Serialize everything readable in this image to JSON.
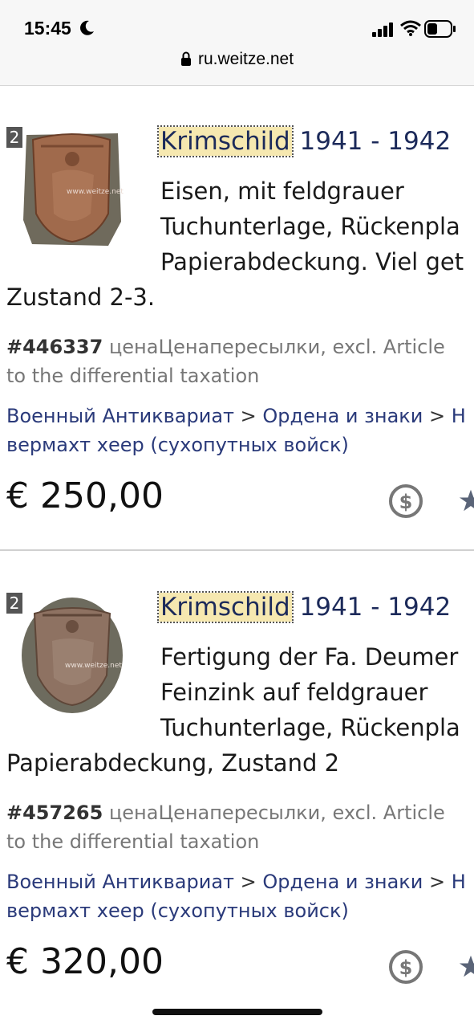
{
  "status": {
    "time": "15:45"
  },
  "browser": {
    "url": "ru.weitze.net"
  },
  "listings": [
    {
      "rank": "2",
      "title_highlight": "Krimschild",
      "title_rest": " 1941 - 1942",
      "desc_lines": [
        "Eisen, mit feldgrauer",
        "Tuchunterlage, Rückenpla",
        "Papierabdeckung. Viel get",
        "Zustand 2-3."
      ],
      "article_no": "#446337",
      "price_note": " ценаЦенапересылки, excl. Article",
      "price_note2": "to the differential taxation",
      "crumbs": [
        {
          "label": "Военный Антиквариат"
        },
        {
          "label": "Ордена и знаки"
        },
        {
          "label": "Н"
        }
      ],
      "crumbs_line2": "вермахт хеер (сухопутных войск)",
      "price": "€ 250,00",
      "watermark": "www.weitze.net"
    },
    {
      "rank": "2",
      "title_highlight": "Krimschild",
      "title_rest": " 1941 - 1942",
      "desc_lines": [
        "Fertigung der Fa. Deumer",
        "Feinzink auf feldgrauer",
        "Tuchunterlage, Rückenpla",
        "Papierabdeckung, Zustand 2"
      ],
      "article_no": "#457265",
      "price_note": " ценаЦенапересылки, excl. Article",
      "price_note2": "to the differential taxation",
      "crumbs": [
        {
          "label": "Военный Антиквариат"
        },
        {
          "label": "Ордена и знаки"
        },
        {
          "label": "Н"
        }
      ],
      "crumbs_line2": "вермахт хеер (сухопутных войск)",
      "price": "€ 320,00",
      "watermark": "www.weitze.net"
    }
  ],
  "colors": {
    "title": "#1c2a5a",
    "link": "#2a3a7a",
    "highlight": "#f6e8b0"
  },
  "icons": [
    "moon-icon",
    "signal-icon",
    "wifi-icon",
    "battery-icon",
    "lock-icon",
    "currency-converter-icon",
    "star-icon"
  ]
}
